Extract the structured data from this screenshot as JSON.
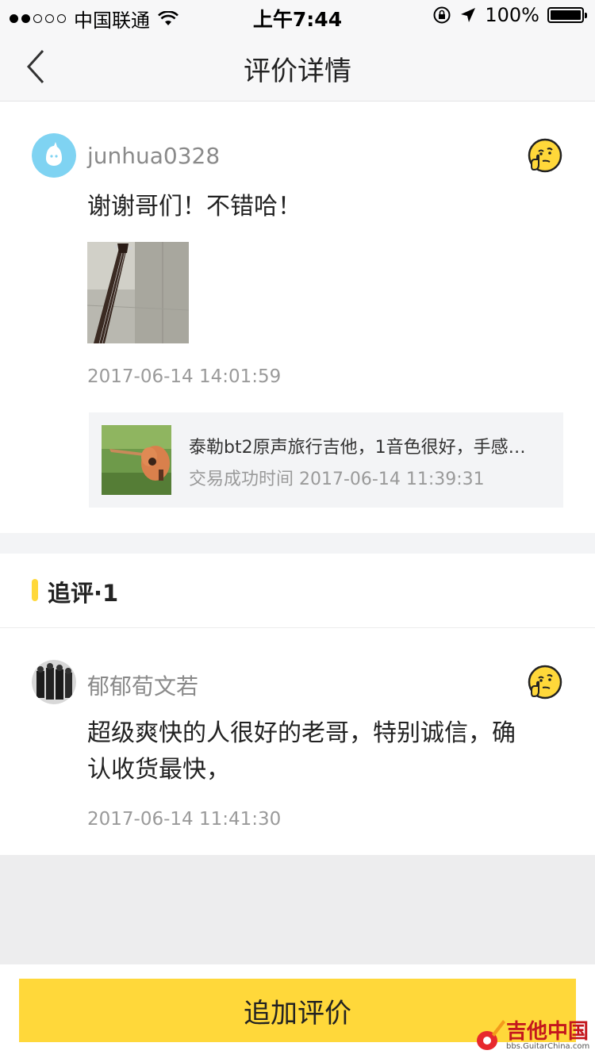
{
  "status_bar": {
    "carrier": "中国联通",
    "time": "上午7:44",
    "battery": "100%"
  },
  "nav": {
    "title": "评价详情"
  },
  "review": {
    "username": "junhua0328",
    "text": "谢谢哥们！不错哈！",
    "timestamp": "2017-06-14 14:01:59",
    "product": {
      "title": "泰勒bt2原声旅行吉他，1音色很好，手感…",
      "trade_time": "交易成功时间 2017-06-14 11:39:31"
    }
  },
  "followup": {
    "header": "追评·1",
    "username": "郁郁荀文若",
    "text_line1": "超级爽快的人很好的老哥，特别诚信，确",
    "text_line2": "认收货最快，",
    "timestamp": "2017-06-14 11:41:30"
  },
  "bottom": {
    "button_label": "追加评价"
  },
  "watermark": {
    "text": "吉他中国",
    "sub": "bbs.GuitarChina.com"
  },
  "colors": {
    "accent": "#ffd83a",
    "muted_text": "#9a9a9a",
    "page_grey": "#ededee"
  }
}
